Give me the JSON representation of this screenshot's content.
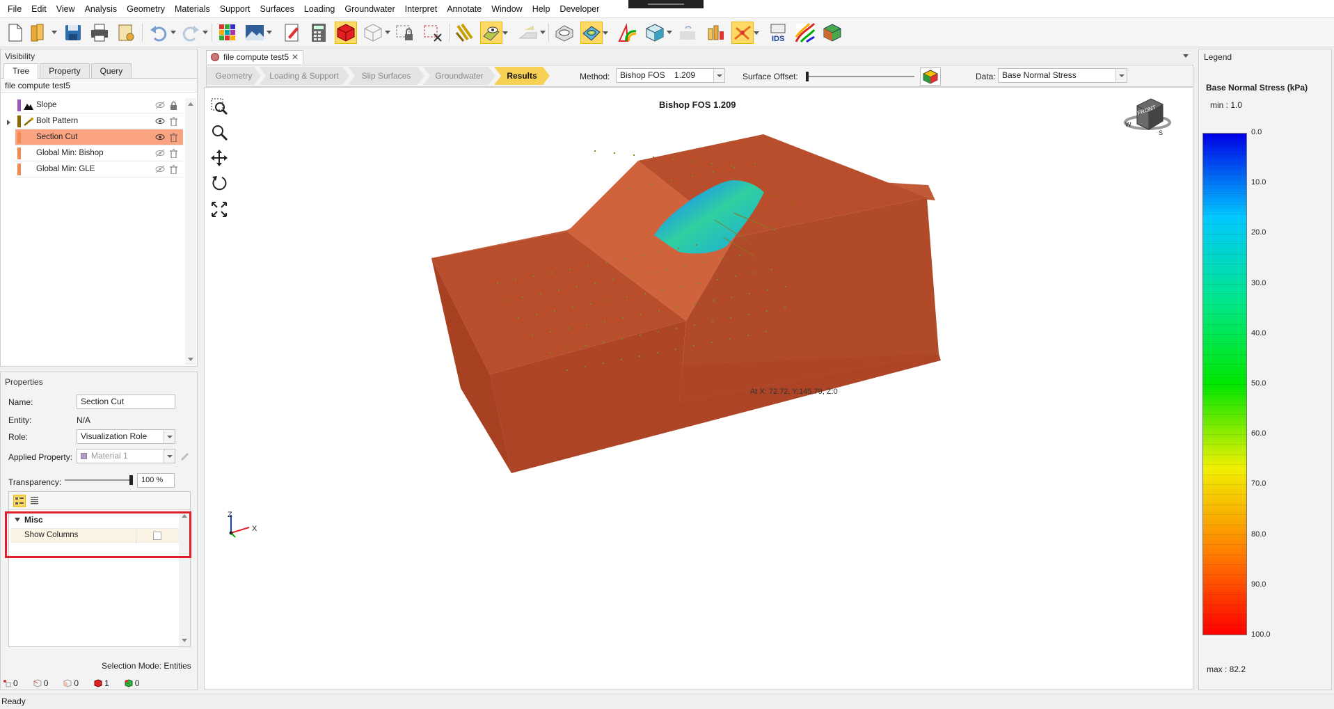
{
  "menu": [
    "File",
    "Edit",
    "View",
    "Analysis",
    "Geometry",
    "Materials",
    "Support",
    "Surfaces",
    "Loading",
    "Groundwater",
    "Interpret",
    "Annotate",
    "Window",
    "Help",
    "Developer"
  ],
  "visibility": {
    "title": "Visibility",
    "tabs": [
      "Tree",
      "Property",
      "Query"
    ],
    "file_label": "file compute test5",
    "items": [
      {
        "label": "Slope",
        "color": "#9b59b6"
      },
      {
        "label": "Bolt Pattern",
        "color": "#8a6a00"
      },
      {
        "label": "Section Cut",
        "color": "#f08a50"
      },
      {
        "label": "Global Min: Bishop",
        "color": "#f08a50"
      },
      {
        "label": "Global Min: GLE",
        "color": "#f08a50"
      }
    ]
  },
  "properties": {
    "title": "Properties",
    "name_label": "Name:",
    "name_value": "Section Cut",
    "entity_label": "Entity:",
    "entity_value": "N/A",
    "role_label": "Role:",
    "role_value": "Visualization Role",
    "applied_label": "Applied Property:",
    "applied_value": "Material 1",
    "transparency_label": "Transparency:",
    "transparency_value": "100 %",
    "misc_header": "Misc",
    "show_columns_label": "Show Columns",
    "selection_mode": "Selection Mode: Entities",
    "counters": [
      "0",
      "0",
      "0",
      "1",
      "0"
    ]
  },
  "document": {
    "tab_label": "file compute test5",
    "close_glyph": "✕"
  },
  "workflow": {
    "steps": [
      "Geometry",
      "Loading & Support",
      "Slip Surfaces",
      "Groundwater",
      "Results"
    ],
    "method_label": "Method:",
    "method_value": "Bishop FOS    1.209",
    "offset_label": "Surface Offset:",
    "data_label": "Data:",
    "data_value": "Base Normal Stress"
  },
  "viewport": {
    "title": "Bishop FOS 1.209",
    "coord_readout": "At X: 72.72, Y:145.79, Z:0",
    "cube_label": "FRONT",
    "axis_labels": {
      "z": "Z",
      "x": "X"
    }
  },
  "legend": {
    "panel_title": "Legend",
    "heading": "Base Normal Stress (kPa)",
    "min_text": "min :  1.0",
    "max_text": "max : 82.2",
    "ticks": [
      "0.0",
      "10.0",
      "20.0",
      "30.0",
      "40.0",
      "50.0",
      "60.0",
      "70.0",
      "80.0",
      "90.0",
      "100.0"
    ],
    "colors": [
      "#0000e6",
      "#00c8ff",
      "#00e68c",
      "#00e600",
      "#f0f000",
      "#ff8000",
      "#ff0000"
    ]
  },
  "status": "Ready"
}
